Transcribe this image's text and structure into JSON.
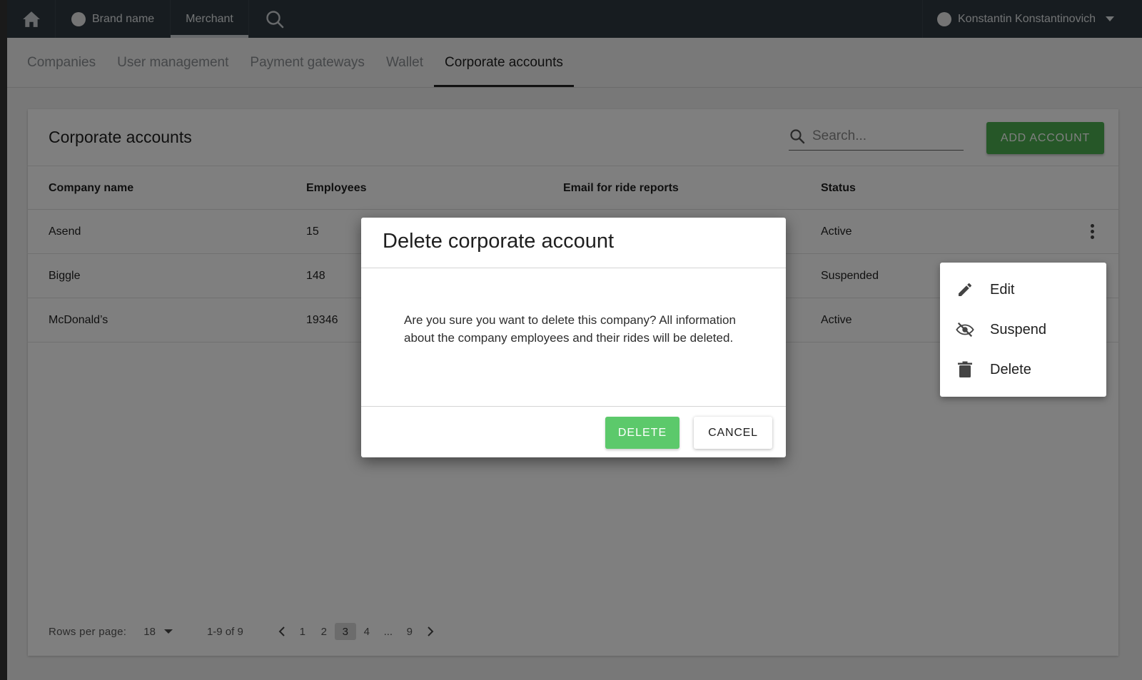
{
  "topbar": {
    "brand": "Brand name",
    "merchant": "Merchant",
    "user": "Konstantin Konstantinovich"
  },
  "subtabs": [
    {
      "label": "Companies"
    },
    {
      "label": "User management"
    },
    {
      "label": "Payment gateways"
    },
    {
      "label": "Wallet"
    },
    {
      "label": "Corporate accounts",
      "active": true
    }
  ],
  "card": {
    "title": "Corporate accounts",
    "search_placeholder": "Search...",
    "add_button": "ADD ACCOUNT"
  },
  "table": {
    "columns": [
      "Company name",
      "Employees",
      "Email for ride reports",
      "Status"
    ],
    "rows": [
      {
        "company": "Asend",
        "employees": "15",
        "status": "Active"
      },
      {
        "company": "Biggle",
        "employees": "148",
        "status": "Suspended"
      },
      {
        "company": "McDonald’s",
        "employees": "19346",
        "status": "Active"
      }
    ]
  },
  "pagination": {
    "rows_per_page_label": "Rows per page:",
    "rows_per_page": "18",
    "range": "1-9 of 9",
    "pages": [
      "1",
      "2",
      "3",
      "4",
      "...",
      "9"
    ],
    "current_page": "3"
  },
  "context_menu": {
    "items": [
      {
        "label": "Edit",
        "icon": "pencil-icon"
      },
      {
        "label": "Suspend",
        "icon": "eye-off-icon"
      },
      {
        "label": "Delete",
        "icon": "trash-icon"
      }
    ]
  },
  "dialog": {
    "title": "Delete corporate account",
    "message": "Are you sure you want to delete this company? All information about the company employees and their rides will be deleted.",
    "confirm": "DELETE",
    "cancel": "CANCEL"
  },
  "colors": {
    "topbar_bg": "#2f3941",
    "accent_green": "#4caf50",
    "delete_green": "#5cc96b"
  }
}
